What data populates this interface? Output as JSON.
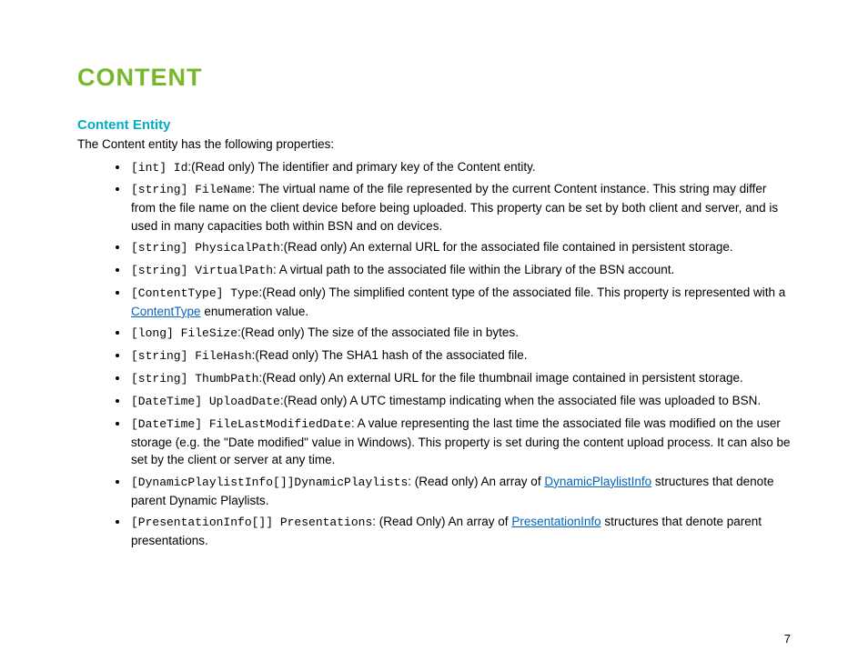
{
  "heading": "CONTENT",
  "subheading": "Content Entity",
  "intro": "The Content entity has the following properties:",
  "properties": [
    {
      "sig": "[int] Id",
      "desc_pre": ":(Read only) The identifier and primary key of the Content entity."
    },
    {
      "sig": "[string] FileName",
      "desc_pre": ": The virtual name of the file represented by the current Content instance. This string may differ from the file name on the client device before being uploaded. This property can be set by both client and server, and is used in many capacities both within BSN and on devices."
    },
    {
      "sig": "[string] PhysicalPath",
      "desc_pre": ":(Read only) An external URL for the associated file contained in persistent storage."
    },
    {
      "sig": "[string] VirtualPath",
      "desc_pre": ": A virtual path to the associated file within the Library of the BSN account."
    },
    {
      "sig": "[ContentType] Type",
      "desc_pre": ":(Read only) The simplified content type of the associated file. This property is represented with a ",
      "link": "ContentType",
      "desc_post": " enumeration value."
    },
    {
      "sig": "[long] FileSize",
      "desc_pre": ":(Read only) The size of the associated file in bytes."
    },
    {
      "sig": "[string] FileHash",
      "desc_pre": ":(Read only) The SHA1 hash of the associated file."
    },
    {
      "sig": "[string] ThumbPath",
      "desc_pre": ":(Read only) An external URL for the file thumbnail image contained in persistent storage."
    },
    {
      "sig": "[DateTime] UploadDate",
      "desc_pre": ":(Read only) A UTC timestamp indicating when the associated file was uploaded to BSN."
    },
    {
      "sig": "[DateTime] FileLastModifiedDate",
      "desc_pre": ": A value representing the last time the associated file was modified on the user storage (e.g. the \"Date modified\" value in Windows). This property is set during the content upload process. It can also be set by the client or server at any time."
    },
    {
      "sig": "[DynamicPlaylistInfo[]]DynamicPlaylists",
      "desc_pre": ": (Read only) An array of ",
      "link": "DynamicPlaylistInfo",
      "desc_post": " structures that denote parent Dynamic Playlists."
    },
    {
      "sig": "[PresentationInfo[]] Presentations",
      "desc_pre": ": (Read Only) An array of ",
      "link": "PresentationInfo",
      "desc_post": " structures that denote parent presentations."
    }
  ],
  "page_number": "7"
}
